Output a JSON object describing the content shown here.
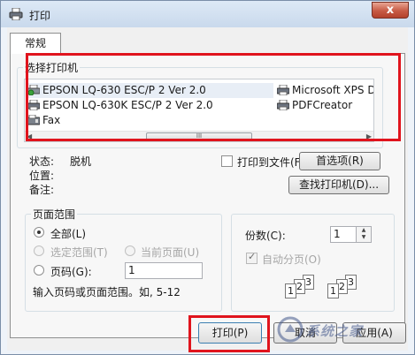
{
  "window": {
    "title": "打印",
    "close_label": "x"
  },
  "tabs": [
    {
      "label": "常规"
    }
  ],
  "printer_group": {
    "label": "选择打印机",
    "printers": [
      {
        "name": "EPSON LQ-630 ESC/P 2 Ver 2.0",
        "icon": "printer-default-icon"
      },
      {
        "name": "Microsoft XPS D",
        "icon": "printer-icon"
      },
      {
        "name": "EPSON LQ-630K ESC/P 2 Ver 2.0",
        "icon": "printer-icon"
      },
      {
        "name": "PDFCreator",
        "icon": "printer-icon"
      },
      {
        "name": "Fax",
        "icon": "fax-icon"
      }
    ],
    "scroll_thumb_label": "III"
  },
  "status": {
    "state_label": "状态:",
    "state_value": "脱机",
    "location_label": "位置:",
    "comment_label": "备注:",
    "print_to_file_label": "打印到文件(F)",
    "preferences_button": "首选项(R)",
    "find_printer_button": "查找打印机(D)..."
  },
  "page_range": {
    "label": "页面范围",
    "all_label": "全部(L)",
    "selection_label": "选定范围(T)",
    "current_page_label": "当前页面(U)",
    "pages_label": "页码(G):",
    "pages_value": "1",
    "hint": "输入页码或页面范围。如, 5-12"
  },
  "copies": {
    "label": "份数(C):",
    "value": "1",
    "collate_label": "自动分页(O)",
    "collate_pages": [
      "1",
      "2",
      "3"
    ]
  },
  "buttons": {
    "print": "打印(P)",
    "cancel": "取消",
    "apply": "应用(A)"
  },
  "watermark": {
    "text": "系统之家"
  },
  "colors": {
    "highlight_frame": "#e0141d"
  }
}
